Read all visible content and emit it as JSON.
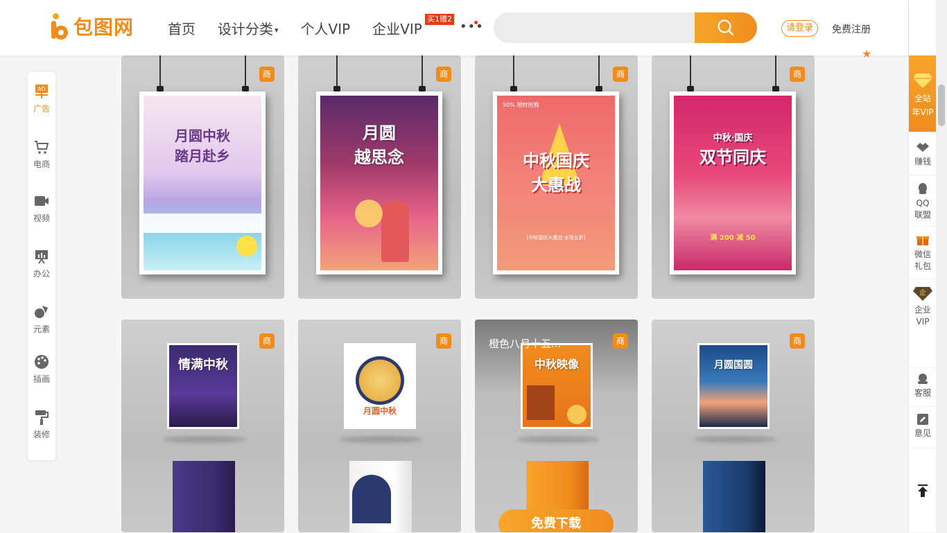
{
  "header": {
    "logo_text": "包图网",
    "nav": [
      {
        "label": "首页"
      },
      {
        "label": "设计分类",
        "caret": "▾"
      },
      {
        "label": "个人VIP"
      },
      {
        "label": "企业VIP",
        "badge": "买1赠2"
      }
    ],
    "more": "•••",
    "search_placeholder": "",
    "login": "请登录",
    "register": "免费注册"
  },
  "left_sidebar": [
    {
      "label": "广告",
      "icon": "ad-icon",
      "active": true
    },
    {
      "label": "电商",
      "icon": "cart-icon"
    },
    {
      "label": "视频",
      "icon": "video-icon"
    },
    {
      "label": "办公",
      "icon": "presentation-icon"
    },
    {
      "label": "元素",
      "icon": "shapes-icon"
    },
    {
      "label": "插画",
      "icon": "palette-icon"
    },
    {
      "label": "装修",
      "icon": "paint-roller-icon"
    }
  ],
  "right_rail": {
    "vip": [
      "全站",
      "年VIP"
    ],
    "items": [
      {
        "lines": [
          "赚钱"
        ],
        "icon": "handshake-icon"
      },
      {
        "lines": [
          "QQ",
          "联盟"
        ],
        "icon": "qq-icon"
      },
      {
        "lines": [
          "微信",
          "礼包"
        ],
        "icon": "gift-icon"
      },
      {
        "lines": [
          "企业",
          "VIP"
        ],
        "icon": "enterprise-diamond-icon"
      },
      {
        "lines": [
          "客服"
        ],
        "icon": "support-icon"
      },
      {
        "lines": [
          "意见"
        ],
        "icon": "feedback-icon"
      }
    ],
    "back_to_top": "back-to-top-icon"
  },
  "badge_label": "商",
  "posters_row1": [
    {
      "lines": [
        "月圆中秋",
        "踏月赴乡"
      ]
    },
    {
      "lines": [
        "月圆",
        "越思念"
      ]
    },
    {
      "lines": [
        "中秋国庆",
        "大惠战"
      ],
      "top_tag": "50% 限时抢购",
      "sub": "[中秋国庆大惠战·全场五折]"
    },
    {
      "lines": [
        "中秋·国庆",
        "双节同庆"
      ],
      "price": "满 200 减 50"
    }
  ],
  "bags_row2": [
    {
      "lines": [
        "情满中秋"
      ]
    },
    {
      "lines": [
        "月圆中秋"
      ]
    },
    {
      "lines": [
        "中秋映像"
      ],
      "hover_title": "橙色八月十五...",
      "download": "免费下载"
    },
    {
      "lines": [
        "月圆国圆"
      ]
    }
  ],
  "colors": {
    "brand": "#f08c1e",
    "brand_light": "#f7a52b",
    "promo_red": "#e8380d"
  }
}
